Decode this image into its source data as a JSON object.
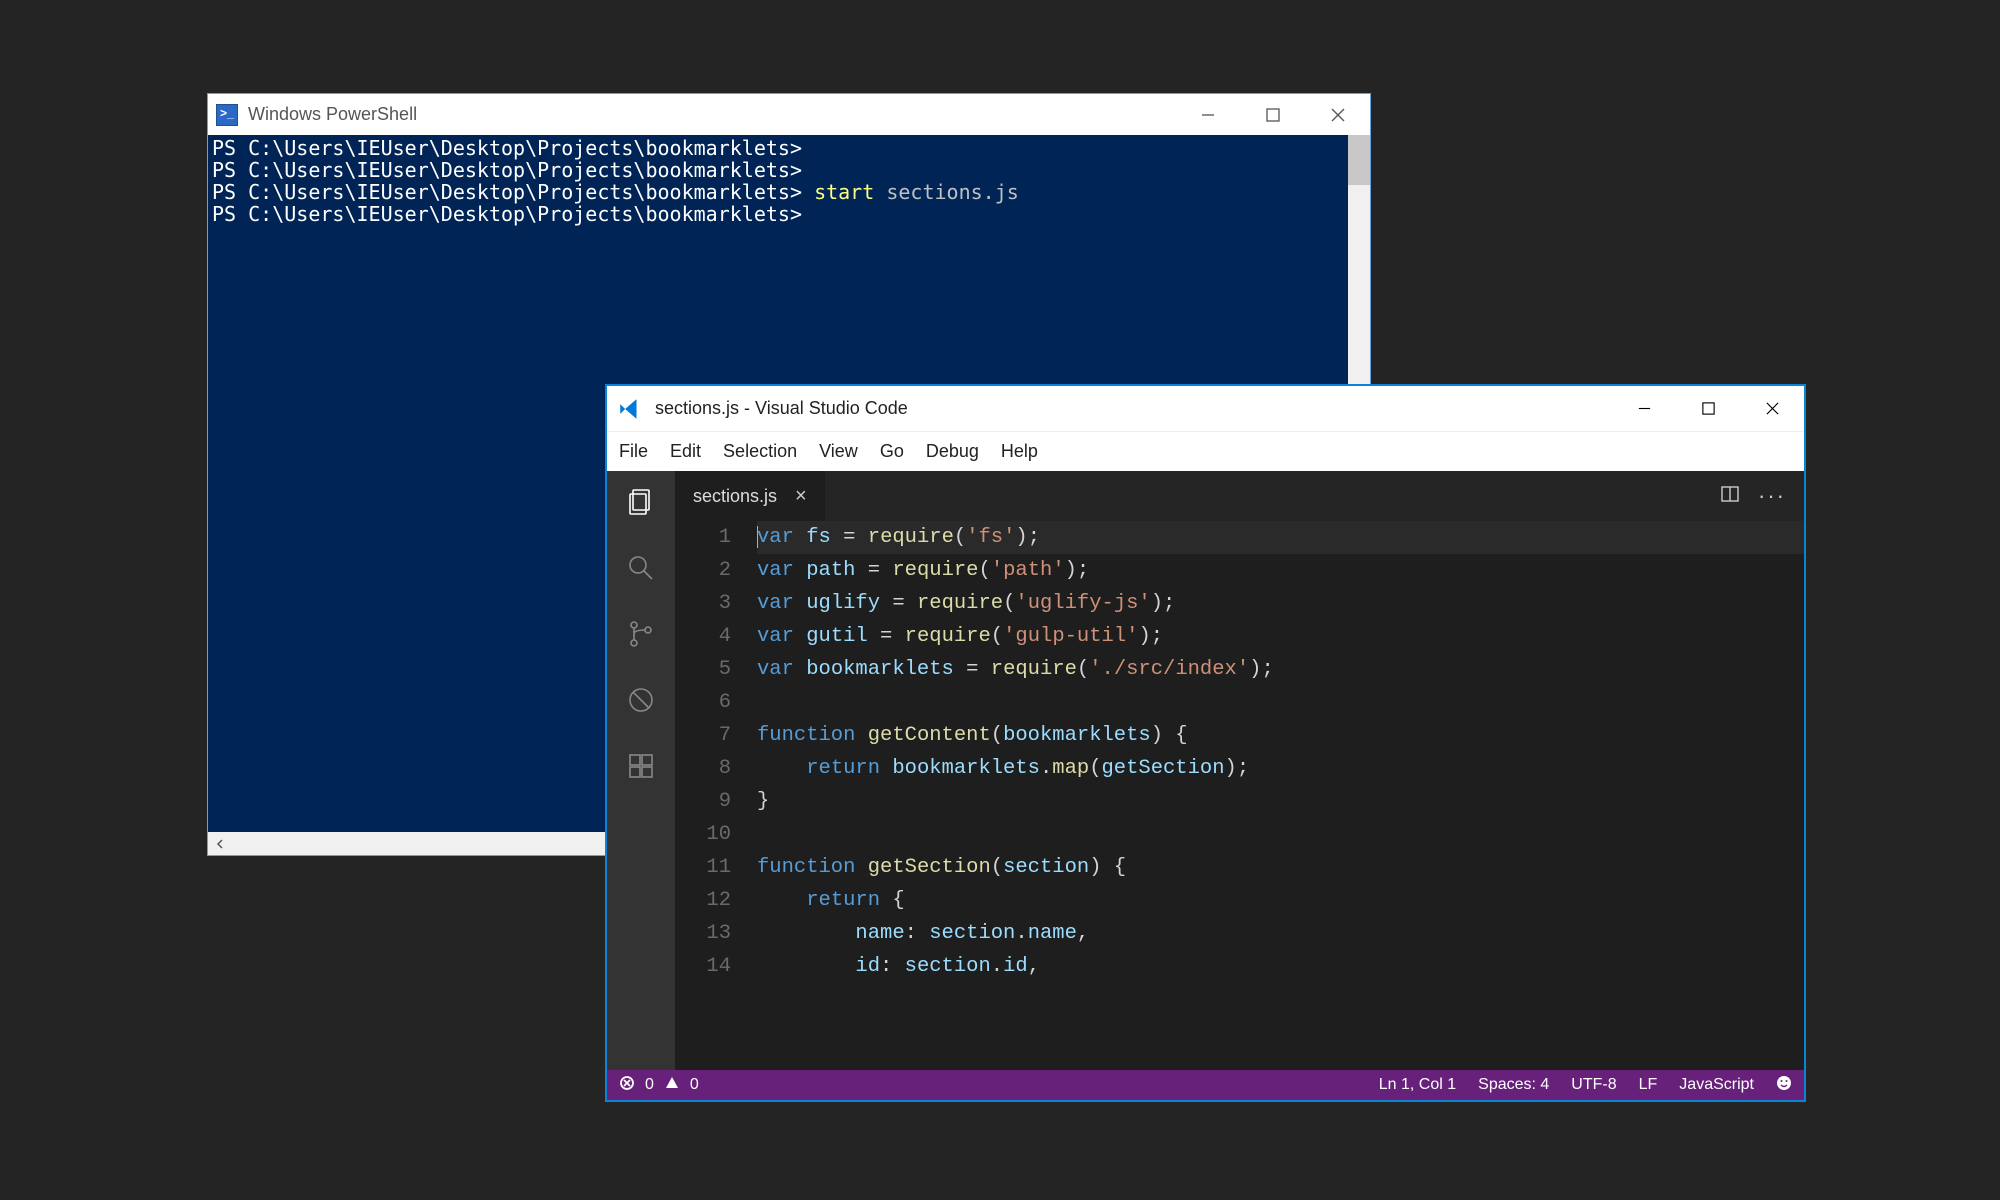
{
  "powershell": {
    "title": "Windows PowerShell",
    "prompt": "PS C:\\Users\\IEUser\\Desktop\\Projects\\bookmarklets>",
    "command": "start",
    "argument": "sections.js",
    "lines": [
      {
        "prompt": true,
        "cmd": "",
        "arg": ""
      },
      {
        "prompt": true,
        "cmd": "",
        "arg": ""
      },
      {
        "prompt": true,
        "cmd": "start",
        "arg": "sections.js"
      },
      {
        "prompt": true,
        "cmd": "",
        "arg": ""
      }
    ]
  },
  "vscode": {
    "title": "sections.js - Visual Studio Code",
    "menu": [
      "File",
      "Edit",
      "Selection",
      "View",
      "Go",
      "Debug",
      "Help"
    ],
    "tab": "sections.js",
    "code": [
      [
        [
          "kw",
          "var"
        ],
        [
          "pn",
          " "
        ],
        [
          "id",
          "fs"
        ],
        [
          "pn",
          " "
        ],
        [
          "op",
          "="
        ],
        [
          "pn",
          " "
        ],
        [
          "fn",
          "require"
        ],
        [
          "pn",
          "("
        ],
        [
          "str",
          "'fs'"
        ],
        [
          "pn",
          ");"
        ]
      ],
      [
        [
          "kw",
          "var"
        ],
        [
          "pn",
          " "
        ],
        [
          "id",
          "path"
        ],
        [
          "pn",
          " "
        ],
        [
          "op",
          "="
        ],
        [
          "pn",
          " "
        ],
        [
          "fn",
          "require"
        ],
        [
          "pn",
          "("
        ],
        [
          "str",
          "'path'"
        ],
        [
          "pn",
          ");"
        ]
      ],
      [
        [
          "kw",
          "var"
        ],
        [
          "pn",
          " "
        ],
        [
          "id",
          "uglify"
        ],
        [
          "pn",
          " "
        ],
        [
          "op",
          "="
        ],
        [
          "pn",
          " "
        ],
        [
          "fn",
          "require"
        ],
        [
          "pn",
          "("
        ],
        [
          "str",
          "'uglify-js'"
        ],
        [
          "pn",
          ");"
        ]
      ],
      [
        [
          "kw",
          "var"
        ],
        [
          "pn",
          " "
        ],
        [
          "id",
          "gutil"
        ],
        [
          "pn",
          " "
        ],
        [
          "op",
          "="
        ],
        [
          "pn",
          " "
        ],
        [
          "fn",
          "require"
        ],
        [
          "pn",
          "("
        ],
        [
          "str",
          "'gulp-util'"
        ],
        [
          "pn",
          ");"
        ]
      ],
      [
        [
          "kw",
          "var"
        ],
        [
          "pn",
          " "
        ],
        [
          "id",
          "bookmarklets"
        ],
        [
          "pn",
          " "
        ],
        [
          "op",
          "="
        ],
        [
          "pn",
          " "
        ],
        [
          "fn",
          "require"
        ],
        [
          "pn",
          "("
        ],
        [
          "str",
          "'./src/index'"
        ],
        [
          "pn",
          ");"
        ]
      ],
      [],
      [
        [
          "kw",
          "function"
        ],
        [
          "pn",
          " "
        ],
        [
          "fn",
          "getContent"
        ],
        [
          "pn",
          "("
        ],
        [
          "id",
          "bookmarklets"
        ],
        [
          "pn",
          ") {"
        ]
      ],
      [
        [
          "pn",
          "    "
        ],
        [
          "kw",
          "return"
        ],
        [
          "pn",
          " "
        ],
        [
          "id",
          "bookmarklets"
        ],
        [
          "pn",
          "."
        ],
        [
          "fn",
          "map"
        ],
        [
          "pn",
          "("
        ],
        [
          "id",
          "getSection"
        ],
        [
          "pn",
          ");"
        ]
      ],
      [
        [
          "pn",
          "}"
        ]
      ],
      [],
      [
        [
          "kw",
          "function"
        ],
        [
          "pn",
          " "
        ],
        [
          "fn",
          "getSection"
        ],
        [
          "pn",
          "("
        ],
        [
          "id",
          "section"
        ],
        [
          "pn",
          ") {"
        ]
      ],
      [
        [
          "pn",
          "    "
        ],
        [
          "kw",
          "return"
        ],
        [
          "pn",
          " {"
        ]
      ],
      [
        [
          "pn",
          "        "
        ],
        [
          "id",
          "name"
        ],
        [
          "pn",
          ": "
        ],
        [
          "id",
          "section"
        ],
        [
          "pn",
          "."
        ],
        [
          "id",
          "name"
        ],
        [
          "pn",
          ","
        ]
      ],
      [
        [
          "pn",
          "        "
        ],
        [
          "id",
          "id"
        ],
        [
          "pn",
          ": "
        ],
        [
          "id",
          "section"
        ],
        [
          "pn",
          "."
        ],
        [
          "id",
          "id"
        ],
        [
          "pn",
          ","
        ]
      ]
    ],
    "status": {
      "errors": "0",
      "warnings": "0",
      "position": "Ln 1, Col 1",
      "spaces": "Spaces: 4",
      "encoding": "UTF-8",
      "eol": "LF",
      "language": "JavaScript"
    }
  }
}
